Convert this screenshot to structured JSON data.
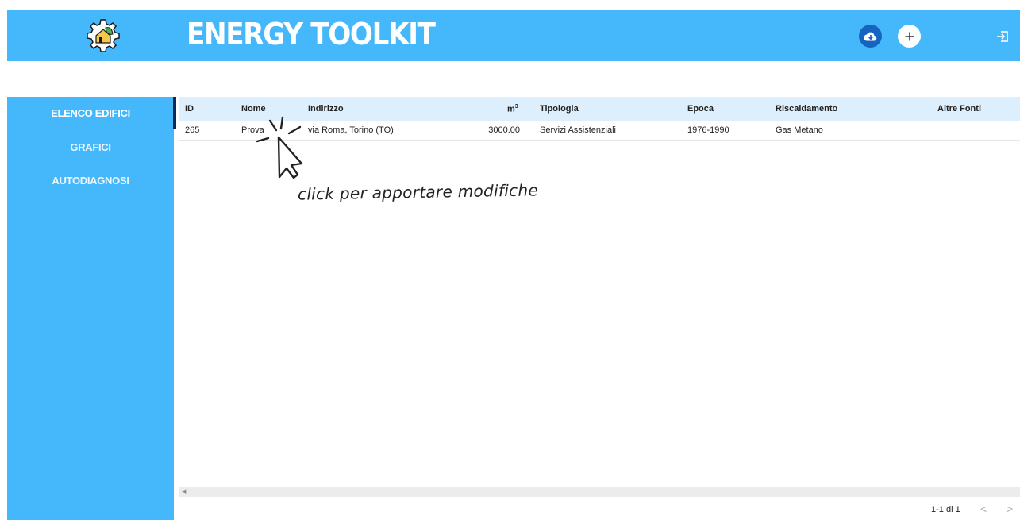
{
  "header": {
    "title": "ENERGY TOOLKIT",
    "logo_icon": "gear-house-leaf-icon",
    "actions": [
      {
        "name": "download-button",
        "icon": "cloud-download-icon"
      },
      {
        "name": "add-button",
        "icon": "plus-icon"
      },
      {
        "name": "logout-button",
        "icon": "logout-icon"
      }
    ]
  },
  "sidebar": {
    "items": [
      {
        "label": "ELENCO EDIFICI",
        "active": true
      },
      {
        "label": "GRAFICI",
        "active": false
      },
      {
        "label": "AUTODIAGNOSI",
        "active": false
      }
    ]
  },
  "table": {
    "columns": {
      "id": "ID",
      "nome": "Nome",
      "indirizzo": "Indirizzo",
      "m3": "m",
      "m3_sup": "3",
      "tipologia": "Tipologia",
      "epoca": "Epoca",
      "riscaldamento": "Riscaldamento",
      "altre_fonti": "Altre Fonti"
    },
    "rows": [
      {
        "id": "265",
        "nome": "Prova",
        "indirizzo": "via Roma, Torino (TO)",
        "m3": "3000.00",
        "tipologia": "Servizi Assistenziali",
        "epoca": "1976-1990",
        "riscaldamento": "Gas Metano",
        "altre_fonti": ""
      }
    ]
  },
  "annotation": {
    "text": "click per apportare modifiche",
    "icon": "cursor-pointer-icon"
  },
  "pagination": {
    "range": "1-1 di 1",
    "prev_icon": "chevron-left-icon",
    "next_icon": "chevron-right-icon"
  },
  "colors": {
    "brand": "#45b7fb",
    "header_row": "#ddeffc",
    "indicator": "#0b2a55",
    "download_button": "#1565c0"
  }
}
